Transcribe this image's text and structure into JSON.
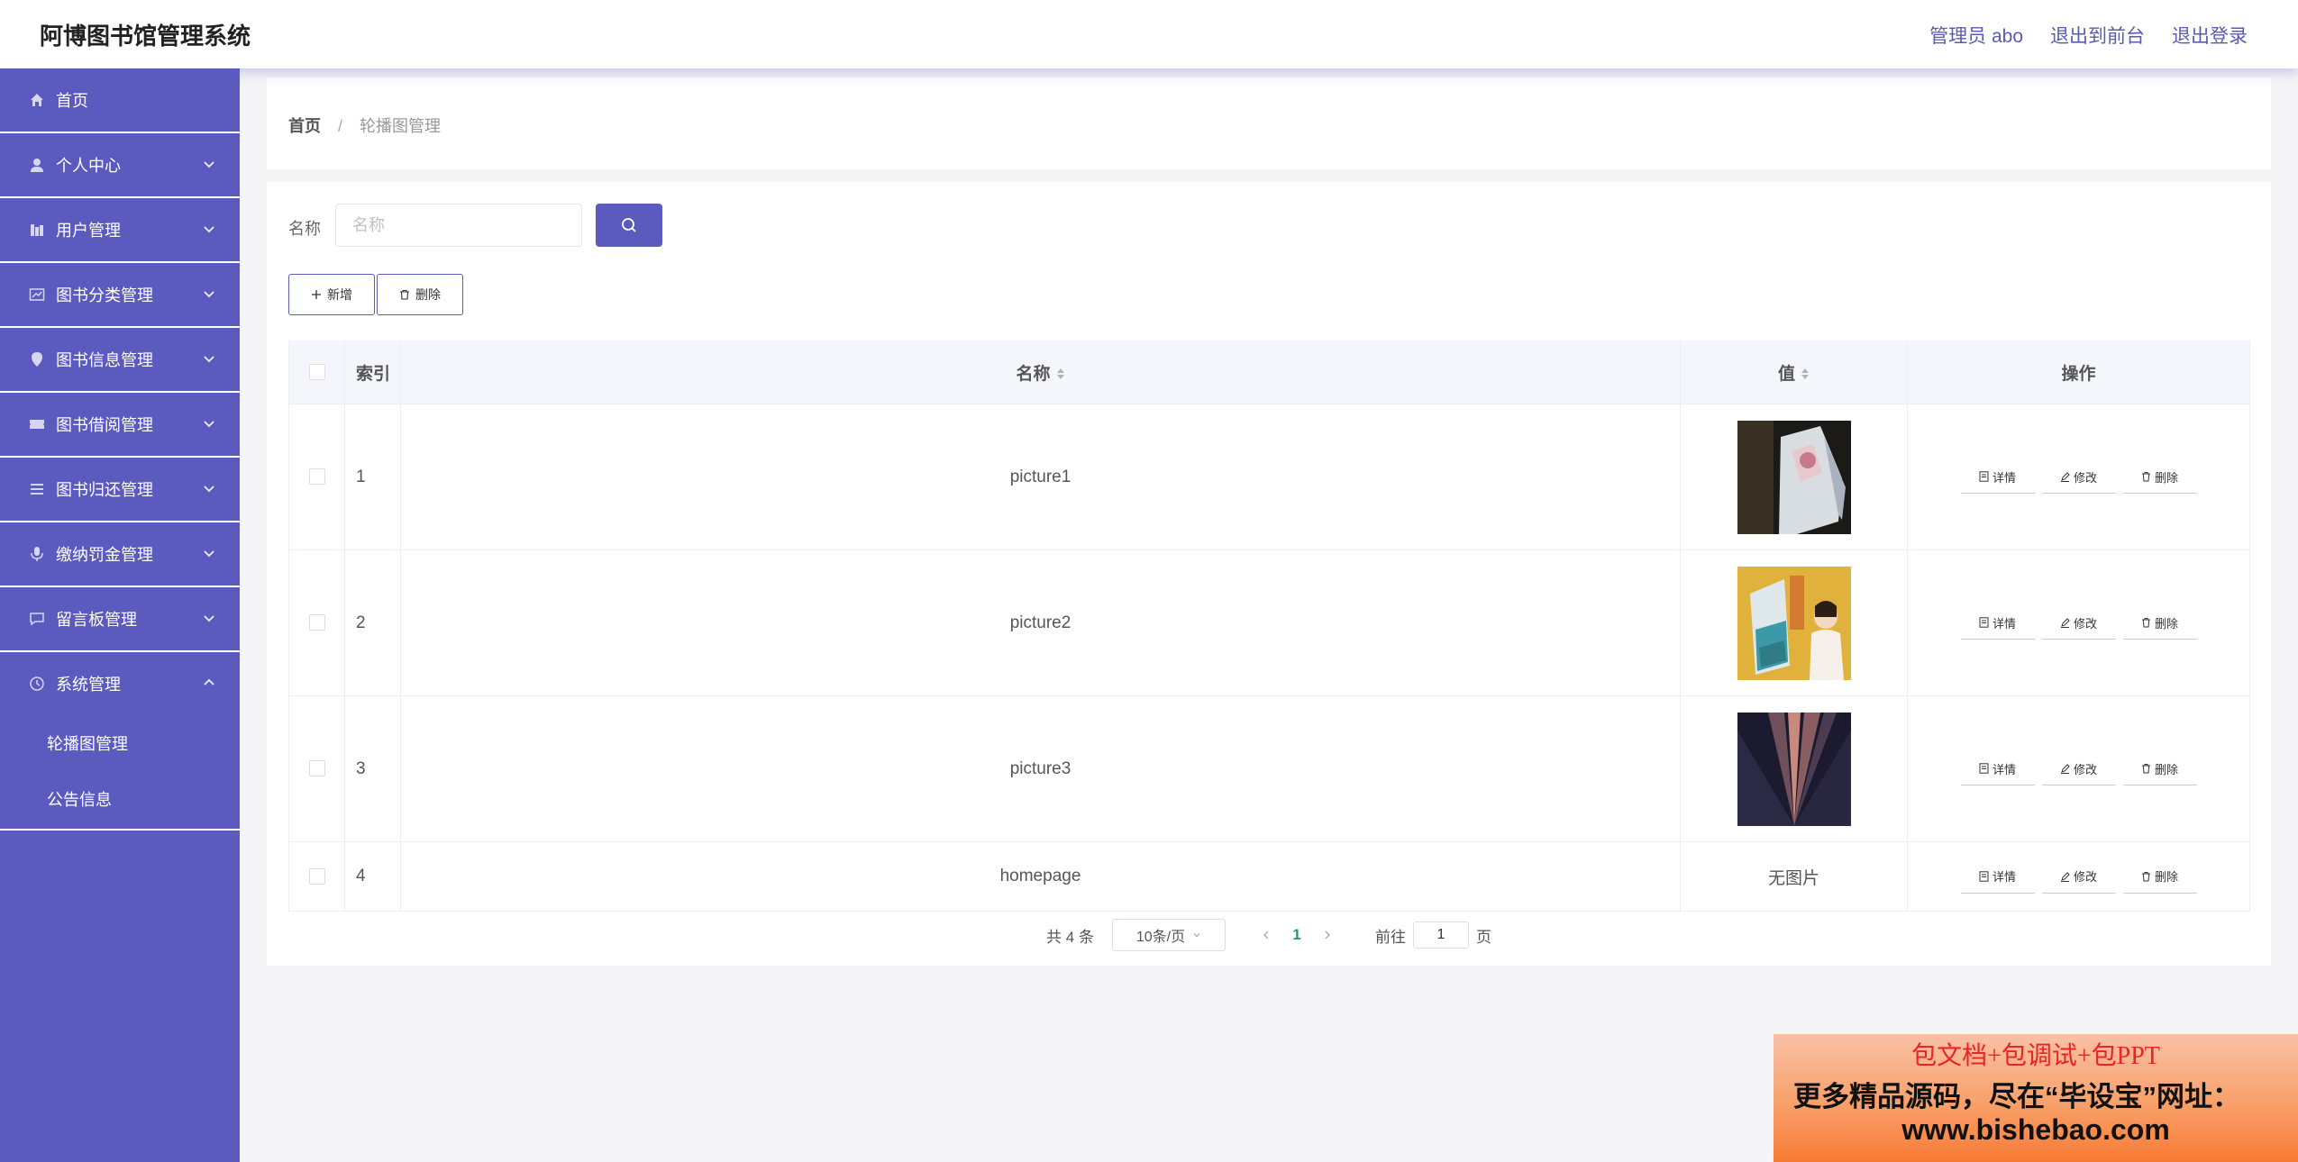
{
  "app": {
    "title": "阿博图书馆管理系统"
  },
  "header": {
    "admin": "管理员 abo",
    "front": "退出到前台",
    "logout": "退出登录"
  },
  "sidebar": {
    "items": [
      {
        "label": "首页",
        "icon": "home-icon"
      },
      {
        "label": "个人中心",
        "icon": "user-icon"
      },
      {
        "label": "用户管理",
        "icon": "users-icon"
      },
      {
        "label": "图书分类管理",
        "icon": "chart-icon"
      },
      {
        "label": "图书信息管理",
        "icon": "location-icon"
      },
      {
        "label": "图书借阅管理",
        "icon": "ticket-icon"
      },
      {
        "label": "图书归还管理",
        "icon": "list-icon"
      },
      {
        "label": "缴纳罚金管理",
        "icon": "microphone-icon"
      },
      {
        "label": "留言板管理",
        "icon": "message-icon"
      },
      {
        "label": "系统管理",
        "icon": "clock-icon"
      }
    ],
    "sub_items": [
      {
        "label": "轮播图管理"
      },
      {
        "label": "公告信息"
      }
    ]
  },
  "breadcrumb": {
    "home": "首页",
    "separator": "/",
    "current": "轮播图管理"
  },
  "search": {
    "label": "名称",
    "placeholder": "名称"
  },
  "actions": {
    "add": "新增",
    "delete": "删除"
  },
  "table": {
    "headers": {
      "index": "索引",
      "name": "名称",
      "value": "值",
      "ops": "操作"
    },
    "rows": [
      {
        "index": "1",
        "name": "picture1",
        "value": "image"
      },
      {
        "index": "2",
        "name": "picture2",
        "value": "image"
      },
      {
        "index": "3",
        "name": "picture3",
        "value": "image"
      },
      {
        "index": "4",
        "name": "homepage",
        "value": "无图片"
      }
    ],
    "ops": {
      "detail": "详情",
      "edit": "修改",
      "delete": "删除"
    }
  },
  "pagination": {
    "total": "共 4 条",
    "page_size": "10条/页",
    "current_page": "1",
    "goto_label": "前往",
    "goto_value": "1",
    "page_unit": "页"
  },
  "promo": {
    "line1": "包文档+包调试+包PPT",
    "line2": "更多精品源码，尽在“毕设宝”网址：",
    "line3": "www.bishebao.com"
  },
  "colors": {
    "accent": "#5b5bbf",
    "active_page": "#2a9a6a",
    "promo_text": "#e8232a"
  }
}
